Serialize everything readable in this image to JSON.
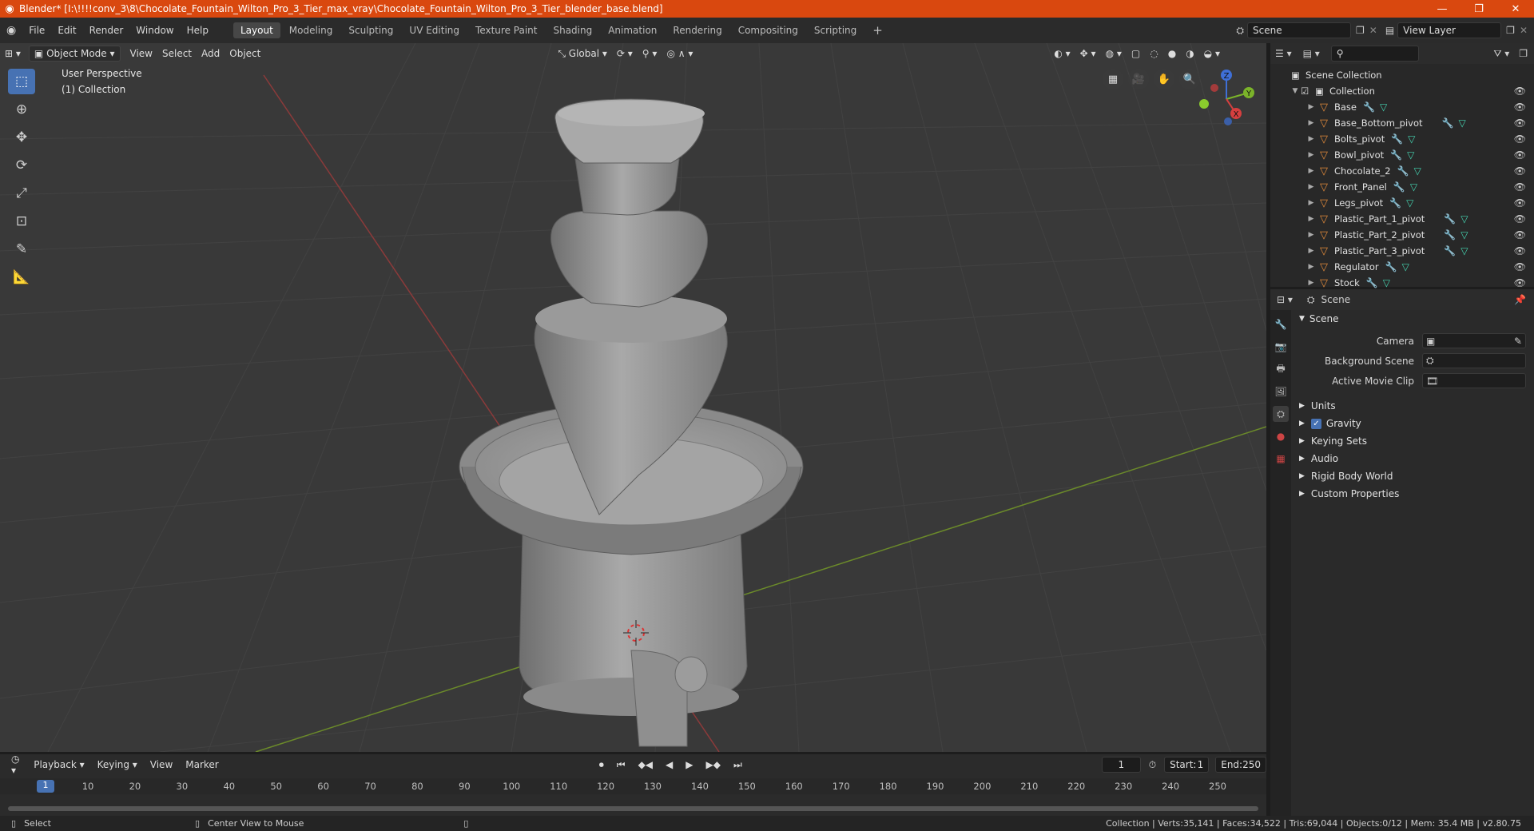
{
  "window": {
    "title": "Blender* [I:\\!!!!conv_3\\8\\Chocolate_Fountain_Wilton_Pro_3_Tier_max_vray\\Chocolate_Fountain_Wilton_Pro_3_Tier_blender_base.blend]"
  },
  "menu": {
    "items": [
      "File",
      "Edit",
      "Render",
      "Window",
      "Help"
    ]
  },
  "workspaces": [
    "Layout",
    "Modeling",
    "Sculpting",
    "UV Editing",
    "Texture Paint",
    "Shading",
    "Animation",
    "Rendering",
    "Compositing",
    "Scripting"
  ],
  "active_workspace": "Layout",
  "scene_selector": "Scene",
  "view_layer": "View Layer",
  "viewport": {
    "mode": "Object Mode",
    "menus": [
      "View",
      "Select",
      "Add",
      "Object"
    ],
    "transform_orientation": "Global",
    "perspective_label": "User Perspective",
    "collection_label": "(1) Collection",
    "gizmo": {
      "x": "X",
      "y": "Y",
      "z": "Z"
    }
  },
  "outliner": {
    "root": "Scene Collection",
    "collection": "Collection",
    "objects": [
      "Base",
      "Base_Bottom_pivot",
      "Bolts_pivot",
      "Bowl_pivot",
      "Chocolate_2",
      "Front_Panel",
      "Legs_pivot",
      "Plastic_Part_1_pivot",
      "Plastic_Part_2_pivot",
      "Plastic_Part_3_pivot",
      "Regulator",
      "Stock"
    ]
  },
  "properties": {
    "header": "Scene",
    "section": "Scene",
    "fields": [
      {
        "label": "Camera"
      },
      {
        "label": "Background Scene"
      },
      {
        "label": "Active Movie Clip"
      }
    ],
    "panels": [
      "Units",
      "Gravity",
      "Keying Sets",
      "Audio",
      "Rigid Body World",
      "Custom Properties"
    ]
  },
  "timeline": {
    "menus": [
      "Playback",
      "Keying",
      "View",
      "Marker"
    ],
    "current_frame": "1",
    "start_label": "Start:",
    "start": "1",
    "end_label": "End:",
    "end": "250",
    "ticks": [
      "1",
      "10",
      "20",
      "30",
      "40",
      "50",
      "60",
      "70",
      "80",
      "90",
      "100",
      "110",
      "120",
      "130",
      "140",
      "150",
      "160",
      "170",
      "180",
      "190",
      "200",
      "210",
      "220",
      "230",
      "240",
      "250"
    ]
  },
  "status": {
    "left": "Select",
    "middle": "Center View to Mouse",
    "right": "Collection | Verts:35,141 | Faces:34,522 | Tris:69,044 | Objects:0/12 | Mem: 35.4 MB | v2.80.75"
  }
}
